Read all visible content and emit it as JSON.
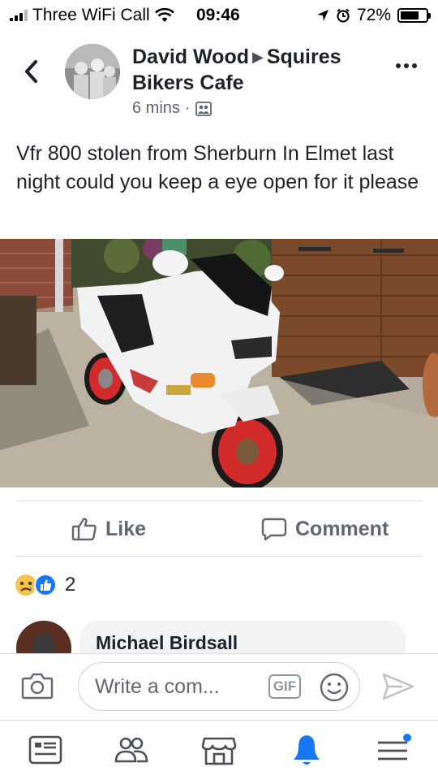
{
  "status_bar": {
    "carrier": "Three WiFi Call",
    "time": "09:46",
    "battery": "72%",
    "battery_level": 0.72
  },
  "post": {
    "author": "David Wood",
    "group": "Squires Bikers Cafe",
    "time_ago": "6 mins",
    "separator": "·",
    "audience_icon": "group-audience-icon",
    "text": "Vfr 800 stolen from Sherburn In Elmet last night could you keep a eye open for it please"
  },
  "actions": {
    "like_label": "Like",
    "comment_label": "Comment"
  },
  "reactions": {
    "types": [
      "sad",
      "like"
    ],
    "count": "2"
  },
  "comment": {
    "author": "Michael Birdsall"
  },
  "composer": {
    "placeholder": "Write a com...",
    "gif_label": "GIF"
  },
  "tab_bar": {
    "items": [
      "news-feed-icon",
      "friends-icon",
      "marketplace-icon",
      "notifications-icon",
      "menu-icon"
    ],
    "active": "notifications-icon"
  },
  "colors": {
    "accent": "#1877f2",
    "text_primary": "#1d2129",
    "text_secondary": "#606770",
    "divider": "#dadde1",
    "bubble": "#f2f3f5"
  }
}
